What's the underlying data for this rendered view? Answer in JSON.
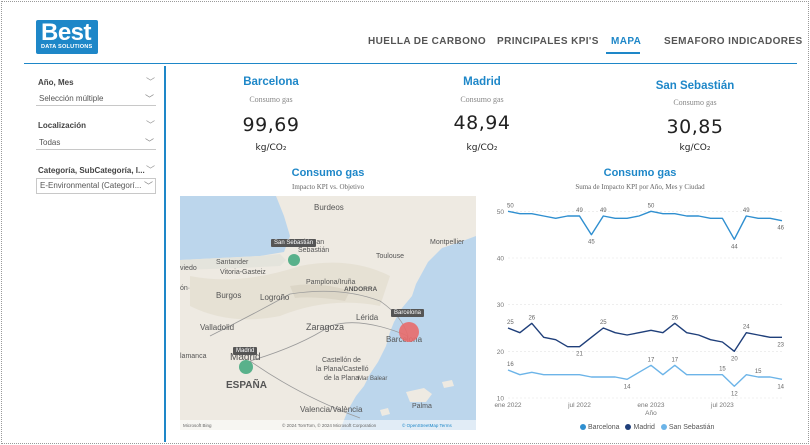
{
  "logo": {
    "main": "Best",
    "sub": "DATA SOLUTIONS"
  },
  "nav": {
    "tabs": [
      {
        "label": "HUELLA DE CARBONO"
      },
      {
        "label": "PRINCIPALES KPI'S"
      },
      {
        "label": "MAPA",
        "active": true
      },
      {
        "label": "SEMAFORO INDICADORES"
      }
    ]
  },
  "filters": [
    {
      "label": "Año, Mes",
      "value": "Selección múltiple"
    },
    {
      "label": "Localización",
      "value": "Todas"
    },
    {
      "label": "Categoría, SubCategoría, I...",
      "value": "E-Environmental (Categorí..."
    }
  ],
  "kpis": [
    {
      "city": "Barcelona",
      "caption": "Consumo gas",
      "value": "99,69",
      "unit": "kg/CO₂"
    },
    {
      "city": "Madrid",
      "caption": "Consumo gas",
      "value": "48,94",
      "unit": "kg/CO₂"
    },
    {
      "city": "San Sebastián",
      "caption": "Consumo gas",
      "value": "30,85",
      "unit": "kg/CO₂"
    }
  ],
  "map_panel": {
    "title": "Consumo gas",
    "subtitle": "Impacto KPI vs. Objetivo",
    "places": [
      "Burdeos",
      "Montpellier",
      "Toulouse",
      "Santander",
      "Vitoria-Gasteiz",
      "Burgos",
      "Logroño",
      "Pamplona/Iruña",
      "ANDORRA",
      "Lérida",
      "Valladolid",
      "Zaragoza",
      "Barcelona",
      "Madrid",
      "Castellón de la Plana/Castelló de la Plana",
      "ESPAÑA",
      "Mar Balear",
      "Valencia/València",
      "Palma",
      "Bordeaux",
      "Oviedo"
    ],
    "tooltips": [
      "San Sebastián",
      "Barcelona",
      "Madrid"
    ],
    "attribution": "© 2024 TomTom, © 2024 Microsoft Corporation",
    "attribution_links": "© OpenStreetMap  Terms",
    "bing": "Microsoft Bing",
    "colors": {
      "water": "#bcd6ec",
      "land": "#eeeae2",
      "barcelona": "#e86b6b",
      "madrid": "#3ea77b",
      "san_sebastian": "#3ea77b"
    }
  },
  "chart_panel": {
    "title": "Consumo gas",
    "subtitle": "Suma de Impacto KPI por Año, Mes y Ciudad",
    "xlabel": "Año"
  },
  "chart_data": {
    "type": "line",
    "x": [
      "2022-01",
      "2022-02",
      "2022-03",
      "2022-04",
      "2022-05",
      "2022-06",
      "2022-07",
      "2022-08",
      "2022-09",
      "2022-10",
      "2022-11",
      "2022-12",
      "2023-01",
      "2023-02",
      "2023-03",
      "2023-04",
      "2023-05",
      "2023-06",
      "2023-07",
      "2023-08",
      "2023-09",
      "2023-10",
      "2023-11",
      "2023-12"
    ],
    "xticks": [
      "ene 2022",
      "jul 2022",
      "ene 2023",
      "jul 2023"
    ],
    "yticks": [
      10,
      20,
      30,
      40,
      50
    ],
    "ylim": [
      10,
      52
    ],
    "xlabel": "Año",
    "series": [
      {
        "name": "Barcelona",
        "color": "#2f8fd0",
        "values": [
          50,
          49.5,
          49.5,
          49,
          48.5,
          49,
          49,
          45,
          49,
          48.5,
          48.5,
          49,
          50,
          49.5,
          49.5,
          49,
          49,
          48.5,
          48.5,
          44,
          49,
          48.5,
          48.5,
          48
        ]
      },
      {
        "name": "Madrid",
        "color": "#1f3f7a",
        "values": [
          25,
          24,
          26,
          23,
          22.5,
          21,
          21,
          23,
          25,
          24,
          23.5,
          24,
          24.5,
          24,
          26,
          24,
          23.5,
          22.5,
          22,
          20,
          24,
          23.5,
          23,
          23
        ]
      },
      {
        "name": "San Sebastián",
        "color": "#6cb4e8",
        "values": [
          16,
          15,
          15.5,
          15,
          15,
          15,
          15,
          14.5,
          14.5,
          14.5,
          14,
          15.5,
          17,
          15,
          17,
          15,
          15,
          15,
          15,
          12.5,
          15,
          14.5,
          14.5,
          14
        ]
      }
    ],
    "labels": [
      {
        "series": 0,
        "i": 0,
        "text": "50"
      },
      {
        "series": 0,
        "i": 6,
        "text": "49"
      },
      {
        "series": 0,
        "i": 7,
        "text": "45"
      },
      {
        "series": 0,
        "i": 8,
        "text": "49"
      },
      {
        "series": 0,
        "i": 12,
        "text": "50"
      },
      {
        "series": 0,
        "i": 19,
        "text": "44"
      },
      {
        "series": 0,
        "i": 20,
        "text": "49"
      },
      {
        "series": 0,
        "i": 23,
        "text": "46"
      },
      {
        "series": 1,
        "i": 0,
        "text": "25"
      },
      {
        "series": 1,
        "i": 2,
        "text": "26"
      },
      {
        "series": 1,
        "i": 6,
        "text": "21"
      },
      {
        "series": 1,
        "i": 8,
        "text": "25"
      },
      {
        "series": 1,
        "i": 14,
        "text": "26"
      },
      {
        "series": 1,
        "i": 19,
        "text": "20"
      },
      {
        "series": 1,
        "i": 20,
        "text": "24"
      },
      {
        "series": 1,
        "i": 23,
        "text": "23"
      },
      {
        "series": 2,
        "i": 0,
        "text": "16"
      },
      {
        "series": 2,
        "i": 10,
        "text": "14"
      },
      {
        "series": 2,
        "i": 12,
        "text": "17"
      },
      {
        "series": 2,
        "i": 14,
        "text": "17"
      },
      {
        "series": 2,
        "i": 18,
        "text": "15"
      },
      {
        "series": 2,
        "i": 19,
        "text": "12"
      },
      {
        "series": 2,
        "i": 21,
        "text": "15"
      },
      {
        "series": 2,
        "i": 23,
        "text": "14"
      }
    ],
    "legend": [
      "Barcelona",
      "Madrid",
      "San Sebastián"
    ]
  }
}
